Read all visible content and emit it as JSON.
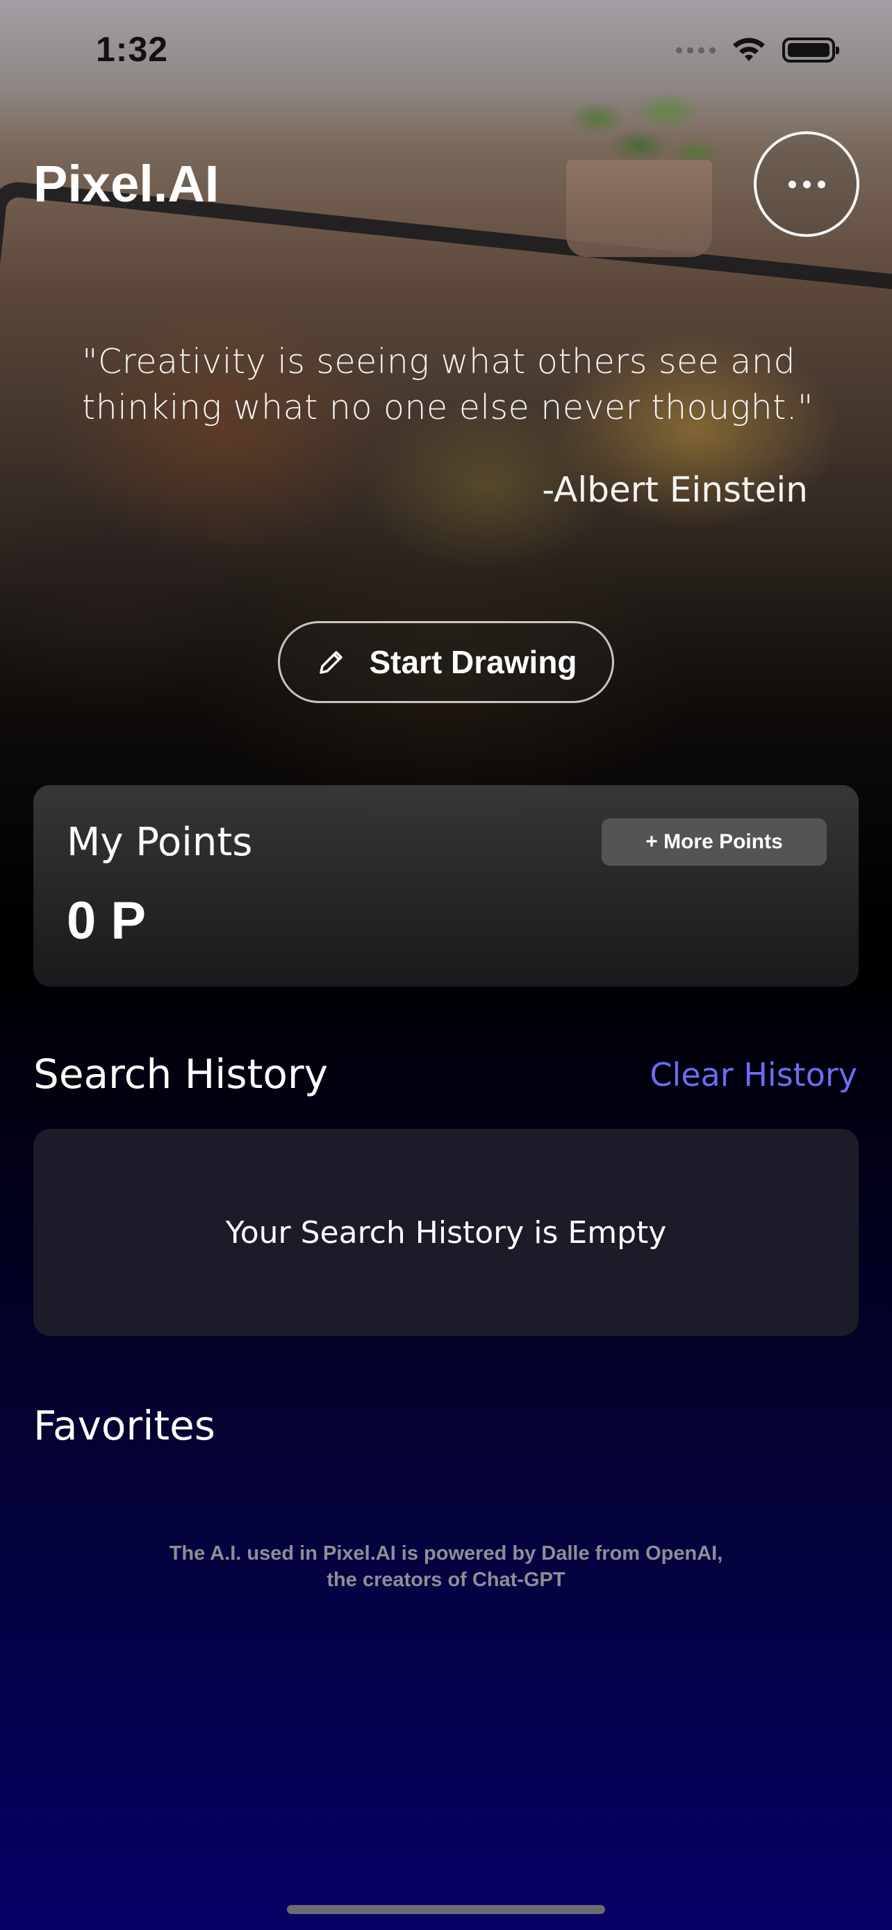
{
  "status_bar": {
    "time": "1:32",
    "icons": [
      "signal-dots-icon",
      "wifi-icon",
      "battery-icon"
    ]
  },
  "header": {
    "title": "Pixel.AI",
    "menu_icon": "ellipsis-icon"
  },
  "quote": {
    "text": "\"Creativity is seeing what others see and thinking what no one else never thought.\"",
    "author": "-Albert Einstein"
  },
  "start_drawing": {
    "label": "Start Drawing",
    "icon": "pencil-icon"
  },
  "points": {
    "label": "My Points",
    "value": "0 P",
    "more_button": "+ More Points"
  },
  "search_history": {
    "title": "Search History",
    "clear_label": "Clear History",
    "empty_message": "Your Search History is Empty"
  },
  "favorites": {
    "title": "Favorites"
  },
  "footer": {
    "note": "The A.I. used in Pixel.AI is powered by Dalle from OpenAI, the creators of Chat-GPT"
  },
  "colors": {
    "accent_link": "#6c6cf2",
    "background_bottom": "#060066",
    "card_background": "#1c1c28"
  }
}
